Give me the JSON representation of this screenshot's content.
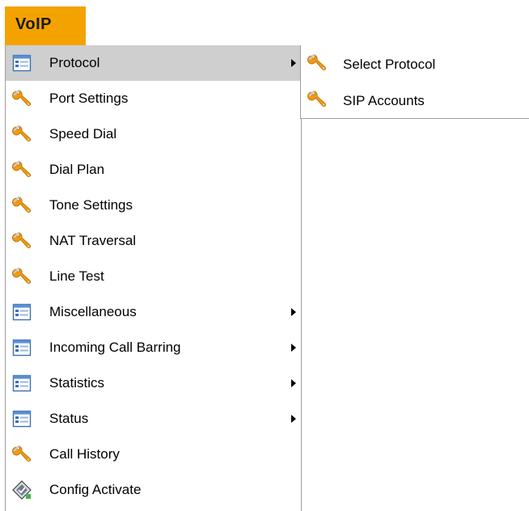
{
  "nav": {
    "title": "VoIP"
  },
  "menu": {
    "items": [
      {
        "label": "Protocol",
        "icon": "list-icon",
        "submenu": true,
        "highlight": true
      },
      {
        "label": "Port Settings",
        "icon": "wrench-icon",
        "submenu": false
      },
      {
        "label": "Speed Dial",
        "icon": "wrench-icon",
        "submenu": false
      },
      {
        "label": "Dial Plan",
        "icon": "wrench-icon",
        "submenu": false
      },
      {
        "label": "Tone Settings",
        "icon": "wrench-icon",
        "submenu": false
      },
      {
        "label": "NAT Traversal",
        "icon": "wrench-icon",
        "submenu": false
      },
      {
        "label": "Line Test",
        "icon": "wrench-icon",
        "submenu": false
      },
      {
        "label": "Miscellaneous",
        "icon": "list-icon",
        "submenu": true
      },
      {
        "label": "Incoming Call Barring",
        "icon": "list-icon",
        "submenu": true
      },
      {
        "label": "Statistics",
        "icon": "list-icon",
        "submenu": true
      },
      {
        "label": "Status",
        "icon": "list-icon",
        "submenu": true
      },
      {
        "label": "Call History",
        "icon": "wrench-icon",
        "submenu": false
      },
      {
        "label": "Config Activate",
        "icon": "activate-icon",
        "submenu": false
      }
    ]
  },
  "submenu": {
    "items": [
      {
        "label": "Select Protocol",
        "icon": "wrench-icon"
      },
      {
        "label": "SIP Accounts",
        "icon": "wrench-icon"
      }
    ]
  },
  "colors": {
    "tab_orange": "#f4a200",
    "highlight_gray": "#cfcfcf",
    "border_gray": "#9e9e9e",
    "list_icon_blue": "#3a6fb4",
    "wrench_orange": "#f09a12"
  }
}
